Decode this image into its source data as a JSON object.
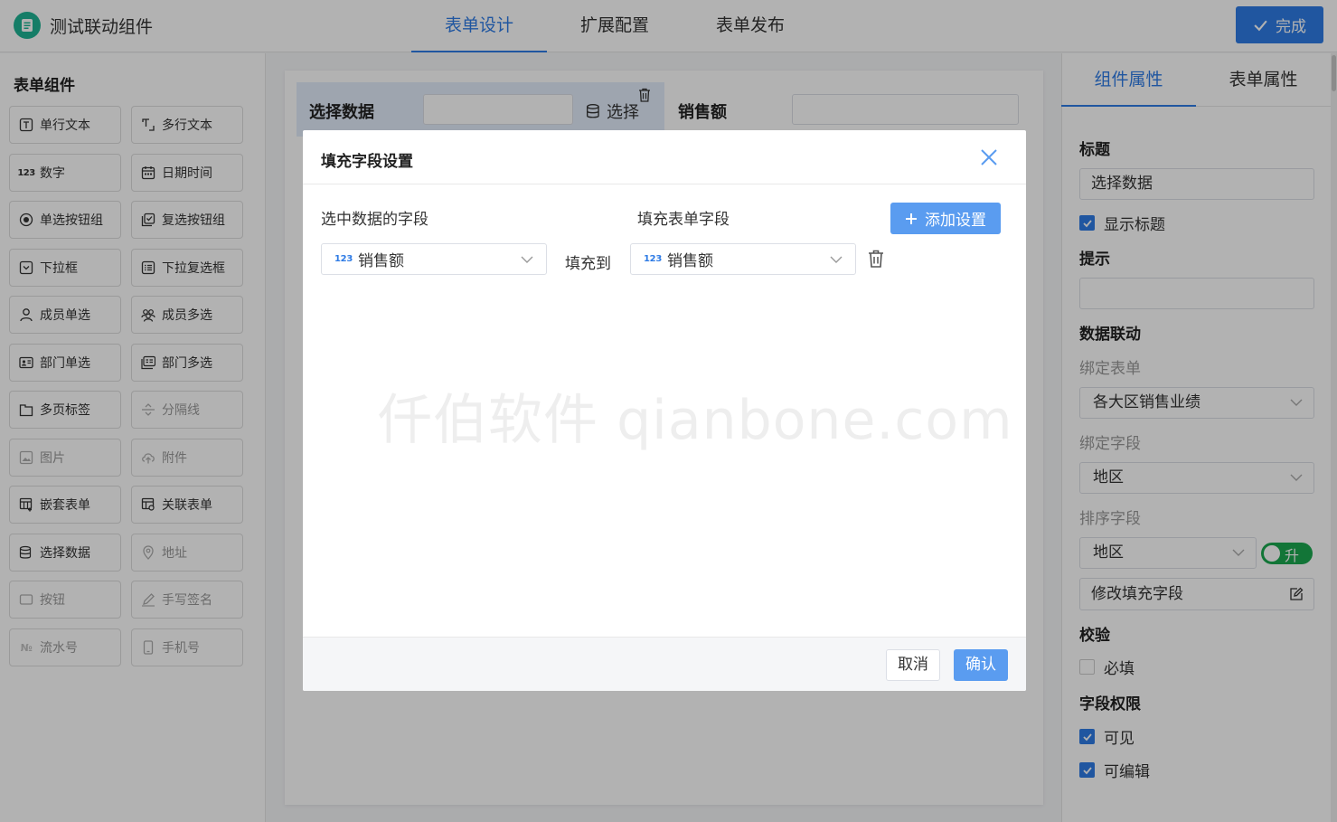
{
  "app": {
    "title": "测试联动组件"
  },
  "top_tabs": [
    {
      "label": "表单设计",
      "active": true
    },
    {
      "label": "扩展配置",
      "active": false
    },
    {
      "label": "表单发布",
      "active": false
    }
  ],
  "done_button": {
    "label": "完成",
    "icon": "check-icon"
  },
  "left_panel": {
    "title": "表单组件",
    "components": [
      {
        "label": "单行文本",
        "icon": "text-box-icon",
        "enabled": true
      },
      {
        "label": "多行文本",
        "icon": "multiline-text-icon",
        "enabled": true
      },
      {
        "label": "数字",
        "icon": "number-123-icon",
        "enabled": true
      },
      {
        "label": "日期时间",
        "icon": "calendar-icon",
        "enabled": true
      },
      {
        "label": "单选按钮组",
        "icon": "radio-icon",
        "enabled": true
      },
      {
        "label": "复选按钮组",
        "icon": "checkbox-group-icon",
        "enabled": true
      },
      {
        "label": "下拉框",
        "icon": "dropdown-icon",
        "enabled": true
      },
      {
        "label": "下拉复选框",
        "icon": "dropdown-multi-icon",
        "enabled": true
      },
      {
        "label": "成员单选",
        "icon": "user-icon",
        "enabled": true
      },
      {
        "label": "成员多选",
        "icon": "users-icon",
        "enabled": true
      },
      {
        "label": "部门单选",
        "icon": "id-card-icon",
        "enabled": true
      },
      {
        "label": "部门多选",
        "icon": "id-cards-icon",
        "enabled": true
      },
      {
        "label": "多页标签",
        "icon": "tab-page-icon",
        "enabled": true
      },
      {
        "label": "分隔线",
        "icon": "divider-icon",
        "enabled": false
      },
      {
        "label": "图片",
        "icon": "image-icon",
        "enabled": false
      },
      {
        "label": "附件",
        "icon": "upload-icon",
        "enabled": false
      },
      {
        "label": "嵌套表单",
        "icon": "nested-table-icon",
        "enabled": true
      },
      {
        "label": "关联表单",
        "icon": "linked-table-icon",
        "enabled": true
      },
      {
        "label": "选择数据",
        "icon": "database-icon",
        "enabled": true
      },
      {
        "label": "地址",
        "icon": "location-pin-icon",
        "enabled": false
      },
      {
        "label": "按钮",
        "icon": "button-icon",
        "enabled": false
      },
      {
        "label": "手写签名",
        "icon": "signature-pen-icon",
        "enabled": false
      },
      {
        "label": "流水号",
        "icon": "serial-number-icon",
        "enabled": false
      },
      {
        "label": "手机号",
        "icon": "mobile-phone-icon",
        "enabled": false
      }
    ]
  },
  "canvas": {
    "field1_label": "选择数据",
    "field1_button": "选择",
    "field2_label": "销售额"
  },
  "right_panel": {
    "tabs": [
      {
        "label": "组件属性",
        "active": true
      },
      {
        "label": "表单属性",
        "active": false
      }
    ],
    "title_section": "标题",
    "title_value": "选择数据",
    "show_title_label": "显示标题",
    "show_title_checked": true,
    "hint_section": "提示",
    "hint_value": "",
    "linkage_section": "数据联动",
    "bind_form_label": "绑定表单",
    "bind_form_value": "各大区销售业绩",
    "bind_field_label": "绑定字段",
    "bind_field_value": "地区",
    "sort_field_label": "排序字段",
    "sort_field_value": "地区",
    "sort_order_label": "升",
    "sort_order_on": true,
    "edit_fill_label": "修改填充字段",
    "validation_section": "校验",
    "required_label": "必填",
    "required_checked": false,
    "perm_section": "字段权限",
    "visible_label": "可见",
    "visible_checked": true,
    "editable_label": "可编辑",
    "editable_checked": true
  },
  "dialog": {
    "title": "填充字段设置",
    "col_source": "选中数据的字段",
    "col_target": "填充表单字段",
    "add_button": "添加设置",
    "row": {
      "source_type_glyph": "123",
      "source_field": "销售额",
      "fill_to": "填充到",
      "target_type_glyph": "123",
      "target_field": "销售额"
    },
    "watermark": "仟伯软件 qianbone.com",
    "cancel": "取消",
    "confirm": "确认"
  },
  "colors": {
    "primary": "#2e7be5",
    "dialog_button": "#5a9cf0",
    "toggle_on": "#1aa84f",
    "logo": "#1fb394"
  }
}
